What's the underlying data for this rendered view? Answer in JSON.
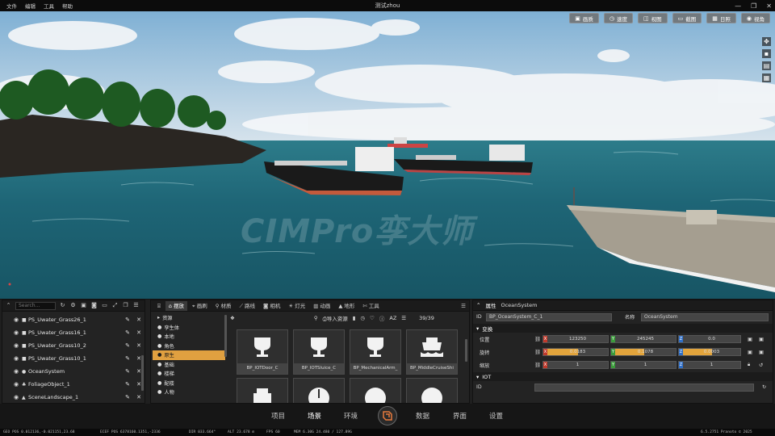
{
  "titlebar": {
    "menus": [
      "文件",
      "编辑",
      "工具",
      "帮助"
    ],
    "title": "测试zhou",
    "controls": [
      "—",
      "❐",
      "✕"
    ]
  },
  "viewport": {
    "toolbar": [
      {
        "icon": "image-icon",
        "label": "画质"
      },
      {
        "icon": "speed-icon",
        "label": "速度"
      },
      {
        "icon": "view-icon",
        "label": "视图"
      },
      {
        "icon": "screenshot-icon",
        "label": "截图"
      },
      {
        "icon": "calendar-icon",
        "label": "日照"
      },
      {
        "icon": "eye-icon",
        "label": "视角"
      }
    ],
    "watermark": "CIMPro孪大师",
    "scene": {
      "sky_top": "#8fb7d6",
      "sky_bottom": "#dbe6ee",
      "sea": "#1d5f70"
    }
  },
  "outliner": {
    "search_placeholder": "Search...",
    "items": [
      {
        "label": "PS_Uwater_Grass26_1"
      },
      {
        "label": "PS_Uwater_Grass16_1"
      },
      {
        "label": "PS_Uwater_Grass10_2"
      },
      {
        "label": "PS_Uwater_Grass10_1"
      },
      {
        "label": "OceanSystem"
      },
      {
        "label": "FoliageObject_1"
      },
      {
        "label": "SceneLandscape_1"
      }
    ]
  },
  "assets": {
    "tabs": [
      "摆放",
      "画刷",
      "材质",
      "路线",
      "相机",
      "灯光",
      "动画",
      "地形",
      "工具"
    ],
    "active_tab": "摆放",
    "categories": [
      "资源",
      "孪生体",
      "本地",
      "角色",
      "原生",
      "基础",
      "楼梯",
      "配楼",
      "人物"
    ],
    "selected_category": "原生",
    "import_label": "导入资源",
    "count": "39/39",
    "tiles": [
      "BP_IOTDoor_C",
      "BP_IOTSluice_C",
      "BP_MechanicalArm_",
      "BP_MiddleCruiseShi",
      "",
      "",
      "",
      ""
    ]
  },
  "properties": {
    "title": "属性",
    "object": "OceanSystem",
    "id_label": "ID",
    "id_value": "BP_OceanSystem_C_1",
    "name_label": "名称",
    "name_value": "OceanSystem",
    "transform_label": "变换",
    "position_label": "位置",
    "rotation_label": "旋转",
    "scale_label": "缩放",
    "position": [
      "123250",
      "245245",
      "0.0"
    ],
    "rotation": [
      "0.0183",
      "0.1078",
      "0.0003"
    ],
    "scale": [
      "1",
      "1",
      "1"
    ],
    "iot_label": "IOT",
    "iot_id_label": "ID",
    "highlight": "#e2a43c"
  },
  "nav": {
    "items": [
      "项目",
      "场景",
      "环境",
      "数据",
      "界面",
      "设置"
    ],
    "active": "场景"
  },
  "status": {
    "geo": "GEO POS  0.012136,-0.021151,23.68",
    "ecef": "ECEF POS  6378160.1351,-2336",
    "dir": "DIR  033.664°",
    "alt": "ALT  23.678 m",
    "fps": "FPS  60",
    "mem": "MEM  6.30G  24.480 / 127.89G",
    "version": "6.5.2751  Pranoto © 2025"
  }
}
